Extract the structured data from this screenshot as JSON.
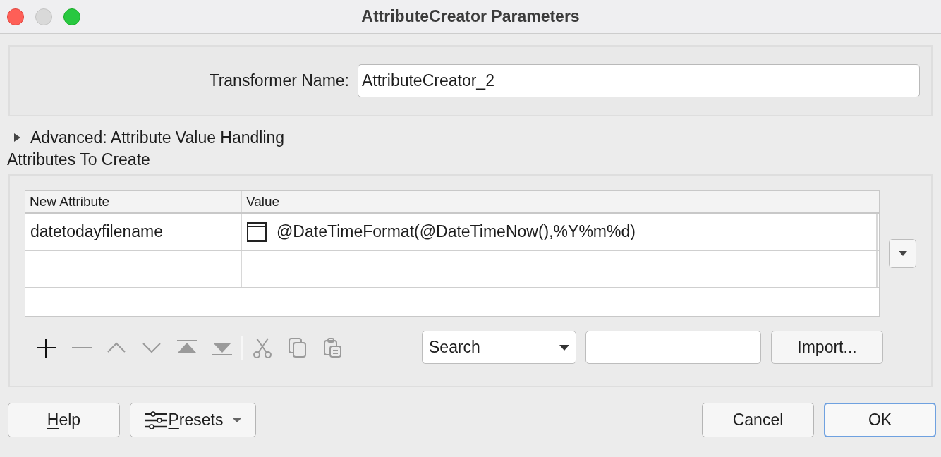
{
  "window": {
    "title": "AttributeCreator Parameters"
  },
  "transformer_name": {
    "label": "Transformer Name:",
    "value": "AttributeCreator_2"
  },
  "advanced": {
    "label": "Advanced: Attribute Value Handling",
    "expanded": false
  },
  "attributes": {
    "title": "Attributes To Create",
    "table": {
      "columns": [
        "New Attribute",
        "Value"
      ],
      "rows": [
        {
          "cells": [
            "datetodayfilename",
            "@DateTimeFormat(@DateTimeNow(),%Y%m%d)"
          ],
          "has_value_icon": true
        },
        {
          "cells": [
            "",
            ""
          ],
          "has_value_icon": false
        }
      ]
    },
    "tools": [
      {
        "kind": "add",
        "disabled": false
      },
      {
        "kind": "remove",
        "disabled": true
      },
      {
        "kind": "up",
        "disabled": true
      },
      {
        "kind": "down",
        "disabled": true
      },
      {
        "kind": "top",
        "disabled": true
      },
      {
        "kind": "bottom",
        "disabled": true
      },
      {
        "kind": "cut",
        "disabled": true
      },
      {
        "kind": "copy",
        "disabled": true
      },
      {
        "kind": "paste",
        "disabled": true
      }
    ],
    "search": {
      "select": "Search"
    },
    "import_button": "Import..."
  },
  "buttons": [
    {
      "label": "Help",
      "mnemonic_underlined": true,
      "kind": "help",
      "default": false
    },
    {
      "label": "Presets",
      "mnemonic_underlined": true,
      "kind": "presets",
      "default": false
    },
    {
      "label": "Cancel",
      "mnemonic_underlined": false,
      "kind": "cancel",
      "default": false
    },
    {
      "label": "OK",
      "mnemonic_underlined": false,
      "kind": "ok",
      "default": true
    }
  ]
}
